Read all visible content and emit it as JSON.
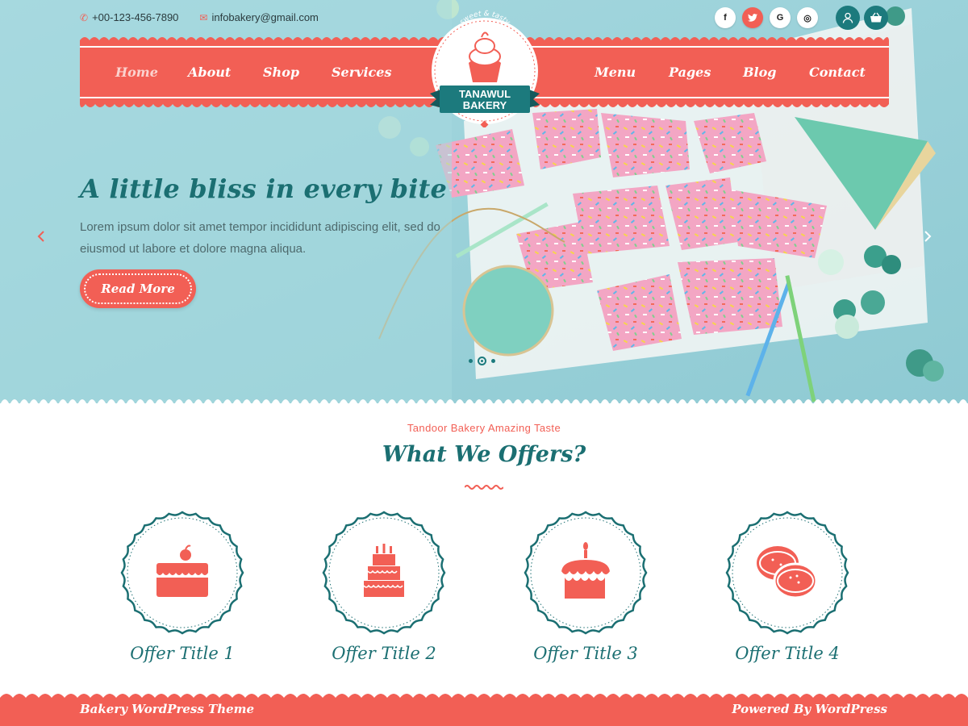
{
  "topbar": {
    "phone": "+00-123-456-7890",
    "email": "infobakery@gmail.com",
    "phone_icon": "phone-icon",
    "email_icon": "envelope-icon"
  },
  "social": [
    {
      "name": "facebook",
      "glyph": "f"
    },
    {
      "name": "twitter",
      "glyph": "t"
    },
    {
      "name": "google",
      "glyph": "G"
    },
    {
      "name": "instagram",
      "glyph": "◎"
    }
  ],
  "nav": {
    "left": [
      "Home",
      "About",
      "Shop",
      "Services"
    ],
    "right": [
      "Menu",
      "Pages",
      "Blog",
      "Contact"
    ],
    "active": "Home"
  },
  "logo": {
    "tagline": "sweet & tasty",
    "line1": "TANAWUL",
    "line2": "BAKERY"
  },
  "hero": {
    "title": "A little bliss in every bite",
    "text": "Lorem ipsum dolor sit amet tempor incididunt adipiscing elit, sed do eiusmod ut labore et dolore magna aliqua.",
    "button": "Read More",
    "prev_icon": "chevron-left-icon",
    "next_icon": "chevron-right-icon",
    "slides": 3,
    "active_slide": 2
  },
  "offers": {
    "subtitle": "Tandoor Bakery Amazing Taste",
    "title": "What We Offers?",
    "items": [
      {
        "title": "Offer Title 1",
        "icon": "cake-slice-icon"
      },
      {
        "title": "Offer Title 2",
        "icon": "tiered-cake-icon"
      },
      {
        "title": "Offer Title 3",
        "icon": "birthday-cake-icon"
      },
      {
        "title": "Offer Title 4",
        "icon": "macaron-icon"
      }
    ]
  },
  "footer": {
    "left": "Bakery WordPress Theme",
    "right": "Powered By WordPress"
  },
  "colors": {
    "coral": "#f25f55",
    "teal": "#1b6f72",
    "hero_bg": "#9fd4dc"
  }
}
